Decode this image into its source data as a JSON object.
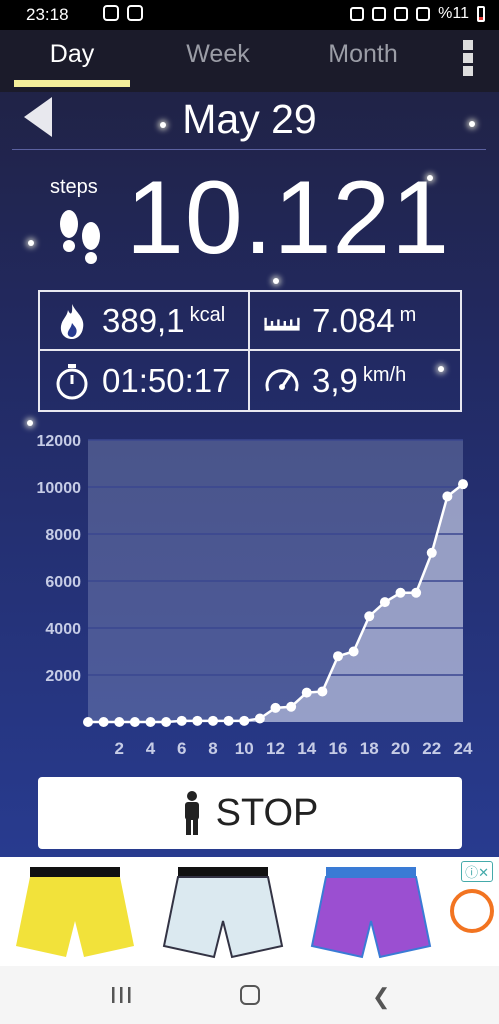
{
  "status_bar": {
    "time": "23:18",
    "battery": "%11"
  },
  "tabs": [
    {
      "label": "Day"
    },
    {
      "label": "Week"
    },
    {
      "label": "Month"
    }
  ],
  "date": "May 29",
  "steps": {
    "label": "steps",
    "value": "10.121"
  },
  "stats": {
    "calories": {
      "value": "389,1",
      "unit": "kcal"
    },
    "distance": {
      "value": "7.084",
      "unit": "m"
    },
    "duration": {
      "value": "01:50:17"
    },
    "speed": {
      "value": "3,9",
      "unit": "km/h"
    }
  },
  "chart_data": {
    "type": "line",
    "x": [
      0,
      1,
      2,
      3,
      4,
      5,
      6,
      7,
      8,
      9,
      10,
      11,
      12,
      13,
      14,
      15,
      16,
      17,
      18,
      19,
      20,
      21,
      22,
      23,
      24
    ],
    "values": [
      0,
      0,
      0,
      0,
      0,
      0,
      50,
      50,
      50,
      50,
      50,
      150,
      600,
      650,
      1250,
      1300,
      2800,
      3000,
      4500,
      5100,
      5500,
      5500,
      7200,
      9600,
      10121
    ],
    "xticks": [
      "2",
      "4",
      "6",
      "8",
      "10",
      "12",
      "14",
      "16",
      "18",
      "20",
      "22",
      "24"
    ],
    "yticks": [
      "2000",
      "4000",
      "6000",
      "8000",
      "10000",
      "12000"
    ],
    "ylim": [
      0,
      12000
    ],
    "xlim": [
      0,
      24
    ],
    "grid": true
  },
  "stop_button": {
    "label": "STOP"
  },
  "colors": {
    "tab_underline": "#f4ee9a",
    "background_top": "#202140",
    "background_bottom": "#283b8f"
  }
}
